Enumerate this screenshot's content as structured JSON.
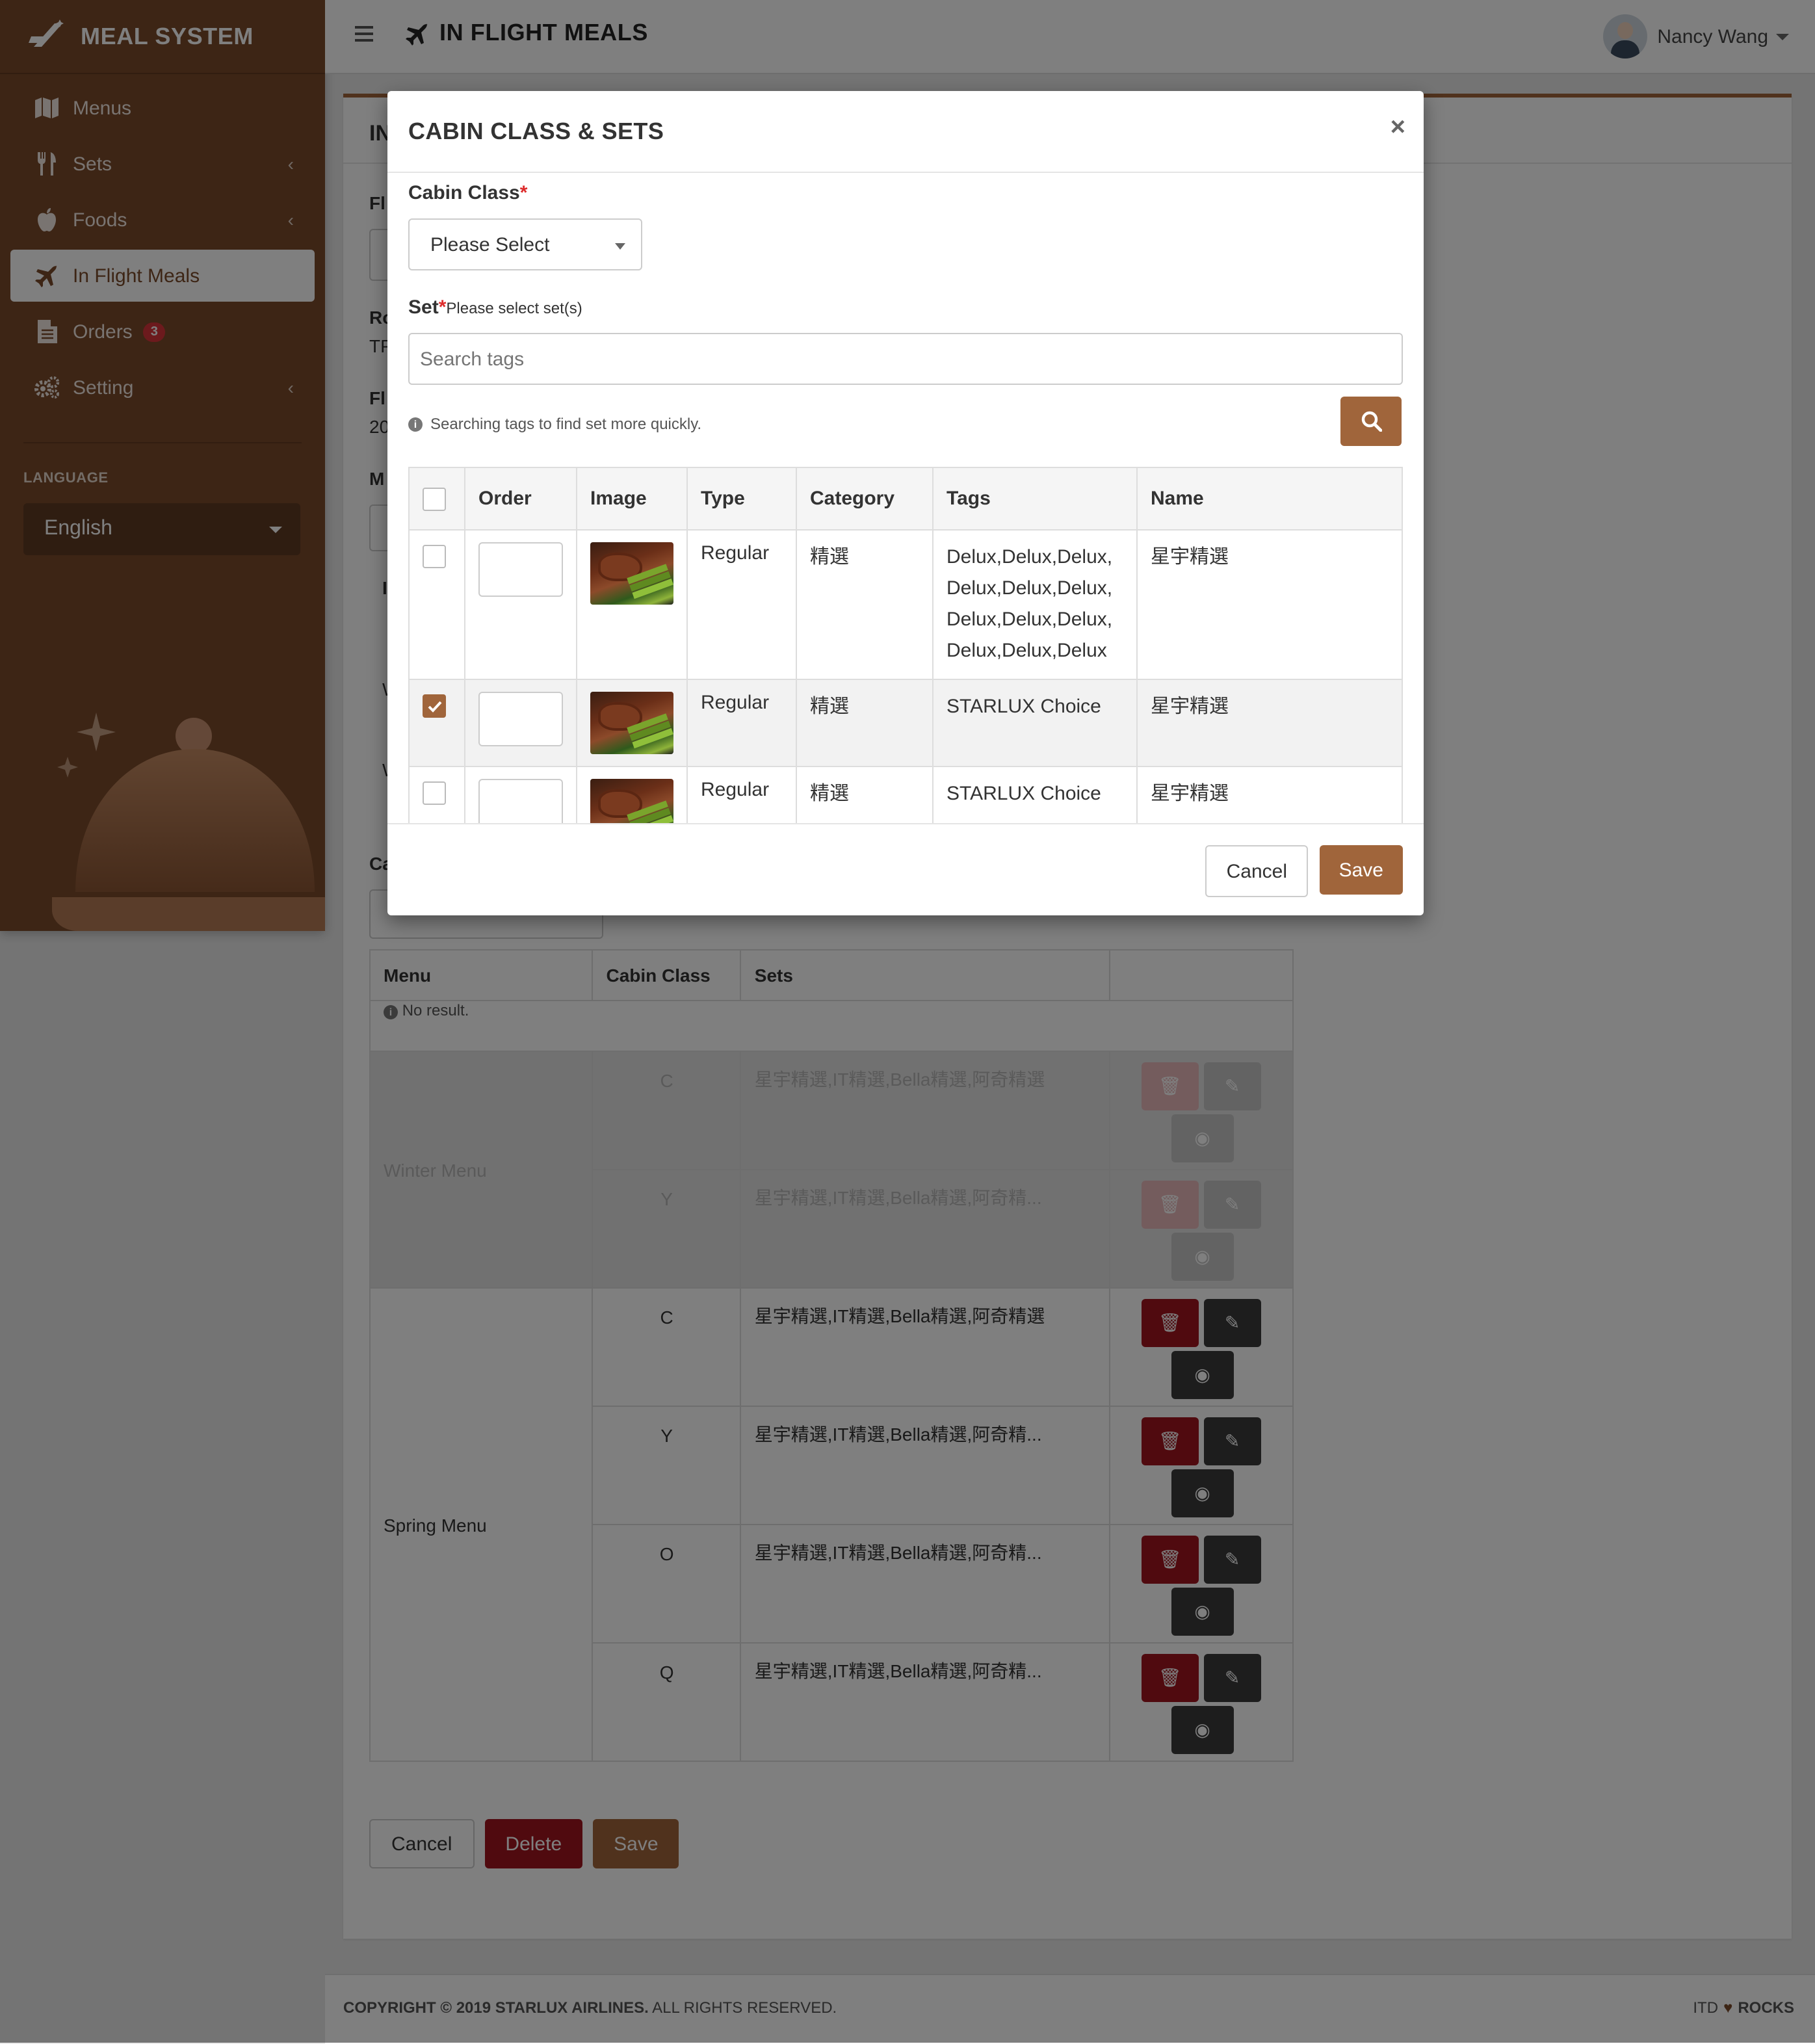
{
  "app": {
    "brand": "MEAL SYSTEM",
    "page_title": "IN FLIGHT MEALS",
    "user_name": "Nancy Wang"
  },
  "sidebar": {
    "items": [
      {
        "label": "Menus",
        "icon": "map-icon"
      },
      {
        "label": "Sets",
        "icon": "utensils-icon",
        "has_children": true
      },
      {
        "label": "Foods",
        "icon": "apple-icon",
        "has_children": true
      },
      {
        "label": "In Flight Meals",
        "icon": "plane-icon",
        "active": true
      },
      {
        "label": "Orders",
        "icon": "document-icon",
        "badge": "3"
      },
      {
        "label": "Setting",
        "icon": "gears-icon",
        "has_children": true
      }
    ],
    "language_label": "LANGUAGE",
    "language_value": "English"
  },
  "background_form": {
    "card_title_fragment": "IN",
    "fragments": [
      "Fl",
      "Ro",
      "TP",
      "Fl",
      "20",
      "M",
      "I",
      "W",
      "W",
      "Ca"
    ],
    "table_headers": [
      "Menu",
      "Cabin Class",
      "Sets",
      ""
    ],
    "no_result": "No result.",
    "groups": [
      {
        "menu": "Winter Menu",
        "disabled": true,
        "rows": [
          {
            "cabin": "C",
            "sets": "星宇精選,IT精選,Bella精選,阿奇精選"
          },
          {
            "cabin": "Y",
            "sets": "星宇精選,IT精選,Bella精選,阿奇精..."
          }
        ]
      },
      {
        "menu": "Spring Menu",
        "disabled": false,
        "rows": [
          {
            "cabin": "C",
            "sets": "星宇精選,IT精選,Bella精選,阿奇精選"
          },
          {
            "cabin": "Y",
            "sets": "星宇精選,IT精選,Bella精選,阿奇精..."
          },
          {
            "cabin": "O",
            "sets": "星宇精選,IT精選,Bella精選,阿奇精..."
          },
          {
            "cabin": "Q",
            "sets": "星宇精選,IT精選,Bella精選,阿奇精..."
          }
        ]
      }
    ],
    "buttons": {
      "cancel": "Cancel",
      "delete": "Delete",
      "save": "Save"
    }
  },
  "footer": {
    "copyright_bold": "COPYRIGHT © 2019 STARLUX AIRLINES.",
    "copyright_rest": " ALL RIGHTS RESERVED.",
    "right_left": "ITD",
    "right_right": "ROCKS"
  },
  "modal": {
    "title": "CABIN CLASS & SETS",
    "close": "×",
    "cabin_label": "Cabin Class",
    "required_mark": "*",
    "cabin_select_value": "Please Select",
    "set_label": "Set",
    "set_hint": "Please select set(s)",
    "search_placeholder": "Search tags",
    "search_hint": "Searching tags to find set more quickly.",
    "table": {
      "headers": [
        "",
        "Order",
        "Image",
        "Type",
        "Category",
        "Tags",
        "Name"
      ],
      "rows": [
        {
          "checked": false,
          "type": "Regular",
          "category": "精選",
          "tags": "Delux,Delux,Delux,Delux,Delux,Delux,Delux,Delux,Delux,Delux,Delux,Delux",
          "name": "星宇精選"
        },
        {
          "checked": true,
          "type": "Regular",
          "category": "精選",
          "tags": "STARLUX Choice",
          "name": "星宇精選"
        },
        {
          "checked": false,
          "type": "Regular",
          "category": "精選",
          "tags": "STARLUX Choice",
          "name": "星宇精選"
        }
      ]
    },
    "cancel": "Cancel",
    "save": "Save"
  },
  "colors": {
    "brand_brown": "#7b4a2a",
    "accent": "#a0653b",
    "danger": "#a0151f",
    "badge_red": "#d9343a"
  }
}
